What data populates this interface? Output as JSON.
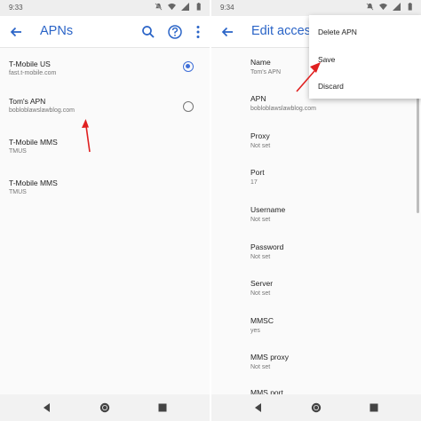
{
  "colors": {
    "accent": "#2a64c7",
    "annotation_arrow": "#e02020"
  },
  "left": {
    "status_time": "9:33",
    "title": "APNs",
    "apns": [
      {
        "name": "T-Mobile US",
        "sub": "fast.t-mobile.com",
        "has_radio": true,
        "selected": true
      },
      {
        "name": "Tom's APN",
        "sub": "bobloblawslawblog.com",
        "has_radio": true,
        "selected": false
      },
      {
        "name": "T-Mobile MMS",
        "sub": "TMUS",
        "has_radio": false,
        "selected": false
      },
      {
        "name": "T-Mobile MMS",
        "sub": "TMUS",
        "has_radio": false,
        "selected": false
      }
    ]
  },
  "right": {
    "status_time": "9:34",
    "title": "Edit access",
    "fields": [
      {
        "label": "Name",
        "value": "Tom's APN"
      },
      {
        "label": "APN",
        "value": "bobloblawslawblog.com"
      },
      {
        "label": "Proxy",
        "value": "Not set"
      },
      {
        "label": "Port",
        "value": "17"
      },
      {
        "label": "Username",
        "value": "Not set"
      },
      {
        "label": "Password",
        "value": "Not set"
      },
      {
        "label": "Server",
        "value": "Not set"
      },
      {
        "label": "MMSC",
        "value": "yes"
      },
      {
        "label": "MMS proxy",
        "value": "Not set"
      },
      {
        "label": "MMS port",
        "value": ""
      }
    ],
    "menu": [
      "Delete APN",
      "Save",
      "Discard"
    ]
  }
}
